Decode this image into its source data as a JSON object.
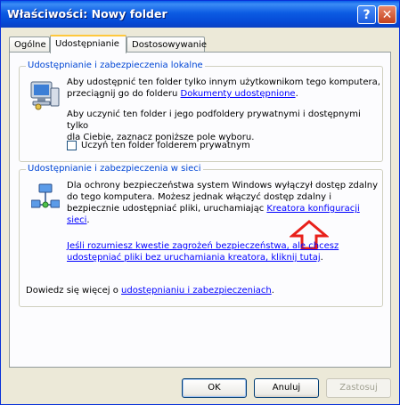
{
  "window": {
    "title": "Właściwości: Nowy folder"
  },
  "tabs": [
    {
      "label": "Ogólne"
    },
    {
      "label": "Udostępnianie"
    },
    {
      "label": "Dostosowywanie"
    }
  ],
  "local_group": {
    "legend": "Udostępnianie i zabezpieczenia lokalne",
    "para1_line1": "Aby udostępnić ten folder tylko innym użytkownikom tego komputera,",
    "para1_line2": "przeciągnij go do folderu ",
    "para1_link": "Dokumenty udostępnione",
    "para1_end": ".",
    "para2_line1": "Aby uczynić ten folder i jego podfoldery prywatnymi i dostępnymi tylko",
    "para2_line2": "dla Ciebie, zaznacz poniższe pole wyboru.",
    "checkbox_label": "Uczyń ten folder folderem prywatnym"
  },
  "network_group": {
    "legend": "Udostępnianie i zabezpieczenia w sieci",
    "line1": "Dla ochrony bezpieczeństwa system Windows wyłączył dostęp zdalny",
    "line2": "do tego komputera. Możesz jednak włączyć dostęp zdalny i",
    "line3": "bezpiecznie udostępniać pliki, uruchamiając ",
    "wizard_link": "Kreatora konfiguracji sieci",
    "line3_end": ".",
    "risk_link_line1": "Jeśli rozumiesz kwestie zagrożeń bezpieczeństwa, ale chcesz",
    "risk_link_line2": "udostępniać pliki bez uruchamiania kreatora, kliknij tutaj",
    "risk_end": "."
  },
  "footer_text": {
    "prefix": "Dowiedz się więcej o ",
    "link": "udostępnianiu i zabezpieczeniach",
    "end": "."
  },
  "buttons": {
    "ok": "OK",
    "cancel": "Anuluj",
    "apply": "Zastosuj"
  },
  "titlebar_buttons": {
    "help": "?",
    "close": "✕"
  },
  "colors": {
    "arrow": "#e8201a",
    "legend": "#0046d5",
    "link": "#0000ff"
  }
}
